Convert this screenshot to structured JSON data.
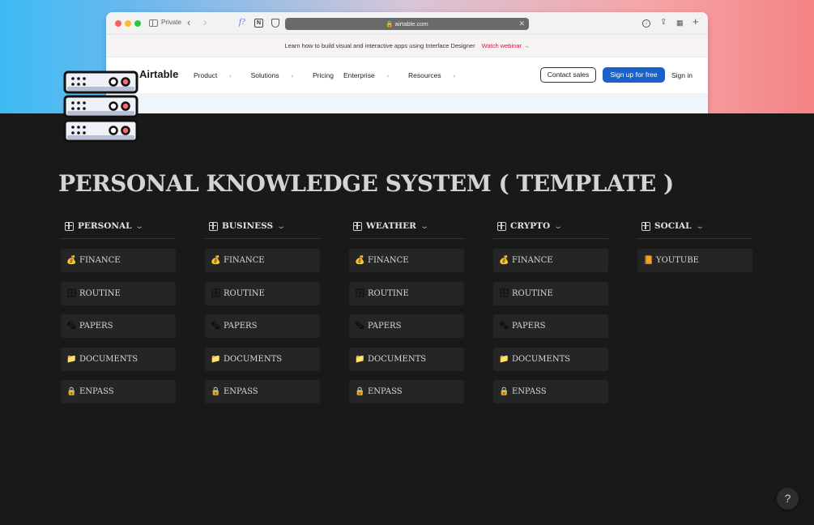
{
  "cover": {
    "browser": {
      "private_label": "Private",
      "url": "airtable.com",
      "banner_text": "Learn how to build visual and interactive apps using Interface Designer",
      "banner_link": "Watch webinar →",
      "logo": "Airtable",
      "menu": [
        "Product",
        "Solutions",
        "Pricing",
        "Enterprise",
        "Resources"
      ],
      "contact_sales": "Contact sales",
      "sign_up": "Sign up for free",
      "sign_in": "Sign in"
    }
  },
  "page": {
    "title": "PERSONAL KNOWLEDGE SYSTEM ( TEMPLATE )",
    "icon": "server-rack-icon"
  },
  "columns": [
    {
      "title": "PERSONAL",
      "items": [
        {
          "icon": "money-bag-icon",
          "glyph": "💰",
          "label": "FINANCE"
        },
        {
          "icon": "file-cabinet-icon",
          "glyph": "🗄",
          "label": "ROUTINE"
        },
        {
          "icon": "newspaper-icon",
          "glyph": "🗞",
          "label": "PAPERS"
        },
        {
          "icon": "folder-icon",
          "glyph": "📁",
          "label": "DOCUMENTS"
        },
        {
          "icon": "lock-icon",
          "glyph": "🔒",
          "label": "ENPASS"
        }
      ]
    },
    {
      "title": "BUSINESS",
      "items": [
        {
          "icon": "money-bag-icon",
          "glyph": "💰",
          "label": "FINANCE"
        },
        {
          "icon": "file-cabinet-icon",
          "glyph": "🗄",
          "label": "ROUTINE"
        },
        {
          "icon": "newspaper-icon",
          "glyph": "🗞",
          "label": "PAPERS"
        },
        {
          "icon": "folder-icon",
          "glyph": "📁",
          "label": "DOCUMENTS"
        },
        {
          "icon": "lock-icon",
          "glyph": "🔒",
          "label": "ENPASS"
        }
      ]
    },
    {
      "title": "WEATHER",
      "items": [
        {
          "icon": "money-bag-icon",
          "glyph": "💰",
          "label": "FINANCE"
        },
        {
          "icon": "file-cabinet-icon",
          "glyph": "🗄",
          "label": "ROUTINE"
        },
        {
          "icon": "newspaper-icon",
          "glyph": "🗞",
          "label": "PAPERS"
        },
        {
          "icon": "folder-icon",
          "glyph": "📁",
          "label": "DOCUMENTS"
        },
        {
          "icon": "lock-icon",
          "glyph": "🔒",
          "label": "ENPASS"
        }
      ]
    },
    {
      "title": "CRYPTO",
      "items": [
        {
          "icon": "money-bag-icon",
          "glyph": "💰",
          "label": "FINANCE"
        },
        {
          "icon": "file-cabinet-icon",
          "glyph": "🗄",
          "label": "ROUTINE"
        },
        {
          "icon": "newspaper-icon",
          "glyph": "🗞",
          "label": "PAPERS"
        },
        {
          "icon": "folder-icon",
          "glyph": "📁",
          "label": "DOCUMENTS"
        },
        {
          "icon": "lock-icon",
          "glyph": "🔒",
          "label": "ENPASS"
        }
      ]
    },
    {
      "title": "SOCIAL",
      "items": [
        {
          "icon": "notebook-icon",
          "glyph": "📙",
          "label": "YOUTUBE"
        }
      ]
    }
  ],
  "help": {
    "label": "?"
  },
  "colors": {
    "background": "#191919",
    "card": "#252525",
    "title": "#d4d4d4",
    "airtable_blue": "#1b61c9",
    "webinar_red": "#c8224a"
  }
}
